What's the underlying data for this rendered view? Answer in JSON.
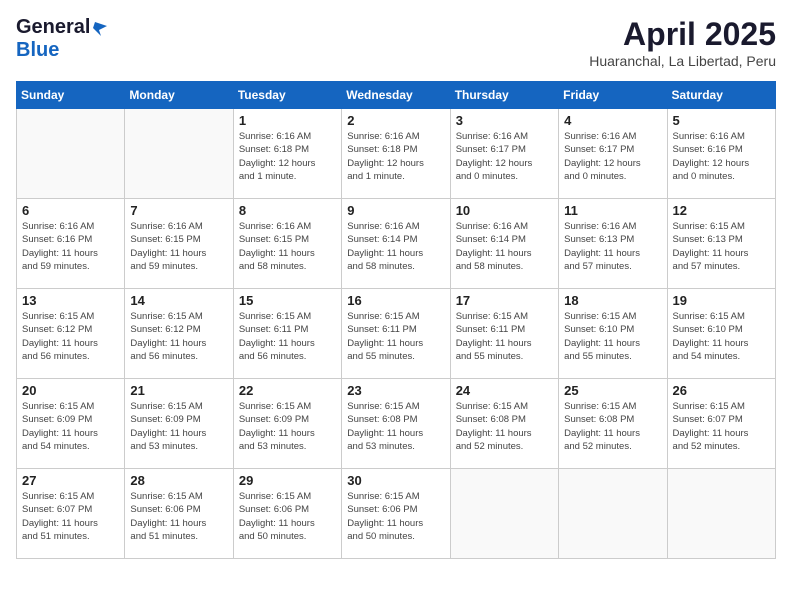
{
  "header": {
    "logo_general": "General",
    "logo_blue": "Blue",
    "title": "April 2025",
    "location": "Huaranchal, La Libertad, Peru"
  },
  "calendar": {
    "days_of_week": [
      "Sunday",
      "Monday",
      "Tuesday",
      "Wednesday",
      "Thursday",
      "Friday",
      "Saturday"
    ],
    "weeks": [
      [
        {
          "day": "",
          "info": ""
        },
        {
          "day": "",
          "info": ""
        },
        {
          "day": "1",
          "info": "Sunrise: 6:16 AM\nSunset: 6:18 PM\nDaylight: 12 hours\nand 1 minute."
        },
        {
          "day": "2",
          "info": "Sunrise: 6:16 AM\nSunset: 6:18 PM\nDaylight: 12 hours\nand 1 minute."
        },
        {
          "day": "3",
          "info": "Sunrise: 6:16 AM\nSunset: 6:17 PM\nDaylight: 12 hours\nand 0 minutes."
        },
        {
          "day": "4",
          "info": "Sunrise: 6:16 AM\nSunset: 6:17 PM\nDaylight: 12 hours\nand 0 minutes."
        },
        {
          "day": "5",
          "info": "Sunrise: 6:16 AM\nSunset: 6:16 PM\nDaylight: 12 hours\nand 0 minutes."
        }
      ],
      [
        {
          "day": "6",
          "info": "Sunrise: 6:16 AM\nSunset: 6:16 PM\nDaylight: 11 hours\nand 59 minutes."
        },
        {
          "day": "7",
          "info": "Sunrise: 6:16 AM\nSunset: 6:15 PM\nDaylight: 11 hours\nand 59 minutes."
        },
        {
          "day": "8",
          "info": "Sunrise: 6:16 AM\nSunset: 6:15 PM\nDaylight: 11 hours\nand 58 minutes."
        },
        {
          "day": "9",
          "info": "Sunrise: 6:16 AM\nSunset: 6:14 PM\nDaylight: 11 hours\nand 58 minutes."
        },
        {
          "day": "10",
          "info": "Sunrise: 6:16 AM\nSunset: 6:14 PM\nDaylight: 11 hours\nand 58 minutes."
        },
        {
          "day": "11",
          "info": "Sunrise: 6:16 AM\nSunset: 6:13 PM\nDaylight: 11 hours\nand 57 minutes."
        },
        {
          "day": "12",
          "info": "Sunrise: 6:15 AM\nSunset: 6:13 PM\nDaylight: 11 hours\nand 57 minutes."
        }
      ],
      [
        {
          "day": "13",
          "info": "Sunrise: 6:15 AM\nSunset: 6:12 PM\nDaylight: 11 hours\nand 56 minutes."
        },
        {
          "day": "14",
          "info": "Sunrise: 6:15 AM\nSunset: 6:12 PM\nDaylight: 11 hours\nand 56 minutes."
        },
        {
          "day": "15",
          "info": "Sunrise: 6:15 AM\nSunset: 6:11 PM\nDaylight: 11 hours\nand 56 minutes."
        },
        {
          "day": "16",
          "info": "Sunrise: 6:15 AM\nSunset: 6:11 PM\nDaylight: 11 hours\nand 55 minutes."
        },
        {
          "day": "17",
          "info": "Sunrise: 6:15 AM\nSunset: 6:11 PM\nDaylight: 11 hours\nand 55 minutes."
        },
        {
          "day": "18",
          "info": "Sunrise: 6:15 AM\nSunset: 6:10 PM\nDaylight: 11 hours\nand 55 minutes."
        },
        {
          "day": "19",
          "info": "Sunrise: 6:15 AM\nSunset: 6:10 PM\nDaylight: 11 hours\nand 54 minutes."
        }
      ],
      [
        {
          "day": "20",
          "info": "Sunrise: 6:15 AM\nSunset: 6:09 PM\nDaylight: 11 hours\nand 54 minutes."
        },
        {
          "day": "21",
          "info": "Sunrise: 6:15 AM\nSunset: 6:09 PM\nDaylight: 11 hours\nand 53 minutes."
        },
        {
          "day": "22",
          "info": "Sunrise: 6:15 AM\nSunset: 6:09 PM\nDaylight: 11 hours\nand 53 minutes."
        },
        {
          "day": "23",
          "info": "Sunrise: 6:15 AM\nSunset: 6:08 PM\nDaylight: 11 hours\nand 53 minutes."
        },
        {
          "day": "24",
          "info": "Sunrise: 6:15 AM\nSunset: 6:08 PM\nDaylight: 11 hours\nand 52 minutes."
        },
        {
          "day": "25",
          "info": "Sunrise: 6:15 AM\nSunset: 6:08 PM\nDaylight: 11 hours\nand 52 minutes."
        },
        {
          "day": "26",
          "info": "Sunrise: 6:15 AM\nSunset: 6:07 PM\nDaylight: 11 hours\nand 52 minutes."
        }
      ],
      [
        {
          "day": "27",
          "info": "Sunrise: 6:15 AM\nSunset: 6:07 PM\nDaylight: 11 hours\nand 51 minutes."
        },
        {
          "day": "28",
          "info": "Sunrise: 6:15 AM\nSunset: 6:06 PM\nDaylight: 11 hours\nand 51 minutes."
        },
        {
          "day": "29",
          "info": "Sunrise: 6:15 AM\nSunset: 6:06 PM\nDaylight: 11 hours\nand 50 minutes."
        },
        {
          "day": "30",
          "info": "Sunrise: 6:15 AM\nSunset: 6:06 PM\nDaylight: 11 hours\nand 50 minutes."
        },
        {
          "day": "",
          "info": ""
        },
        {
          "day": "",
          "info": ""
        },
        {
          "day": "",
          "info": ""
        }
      ]
    ]
  }
}
